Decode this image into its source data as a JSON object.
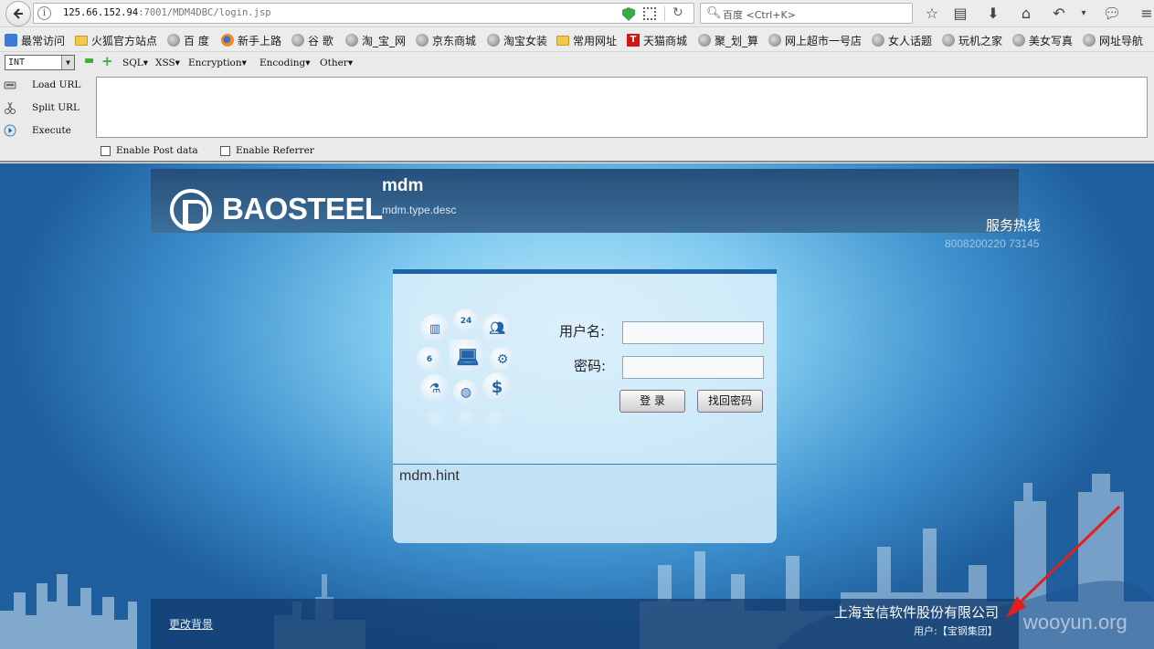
{
  "browser": {
    "url_host": "125.66.152.94",
    "url_path": ":7001/MDM4DBC/login.jsp",
    "search_placeholder": "百度 <Ctrl+K>",
    "search_engine_icon": "search-icon"
  },
  "bookmarks": [
    {
      "label": "最常访问",
      "icon": "most-visited-icon"
    },
    {
      "label": "火狐官方站点",
      "icon": "folder-icon"
    },
    {
      "label": "百 度",
      "icon": "globe-icon"
    },
    {
      "label": "新手上路",
      "icon": "firefox-icon"
    },
    {
      "label": "谷 歌",
      "icon": "globe-icon"
    },
    {
      "label": "淘_宝_网",
      "icon": "globe-icon"
    },
    {
      "label": "京东商城",
      "icon": "globe-icon"
    },
    {
      "label": "淘宝女装",
      "icon": "globe-icon"
    },
    {
      "label": "常用网址",
      "icon": "folder-icon"
    },
    {
      "label": "天猫商城",
      "icon": "tmall-icon"
    },
    {
      "label": "聚_划_算",
      "icon": "globe-icon"
    },
    {
      "label": "网上超市一号店",
      "icon": "globe-icon"
    },
    {
      "label": "女人话题",
      "icon": "globe-icon"
    },
    {
      "label": "玩机之家",
      "icon": "globe-icon"
    },
    {
      "label": "美女写真",
      "icon": "globe-icon"
    },
    {
      "label": "网址导航",
      "icon": "globe-icon"
    }
  ],
  "hackbar": {
    "type_select": "INT",
    "menus": [
      "SQL▾",
      "XSS▾",
      "Encryption▾",
      "Encoding▾",
      "Other▾"
    ],
    "load_url": "Load URL",
    "split_url": "Split URL",
    "execute": "Execute",
    "enable_post": "Enable Post data",
    "enable_referrer": "Enable Referrer"
  },
  "page": {
    "logo_text": "BAOSTEEL",
    "app_title": "mdm",
    "app_desc": "mdm.type.desc",
    "hotline_label": "服务热线",
    "hotline_number": "8008200220 73145",
    "login": {
      "username_label": "用户名:",
      "password_label": "密码:",
      "login_button": "登 录",
      "recover_button": "找回密码",
      "hint": "mdm.hint",
      "icon_badge_24": "24",
      "icon_badge_6": "6",
      "icon_dollar": "$"
    },
    "footer": {
      "change_bg": "更改背景",
      "company": "上海宝信软件股份有限公司",
      "user_line": "用户:【宝钢集团】"
    },
    "watermark": "wooyun.org"
  }
}
